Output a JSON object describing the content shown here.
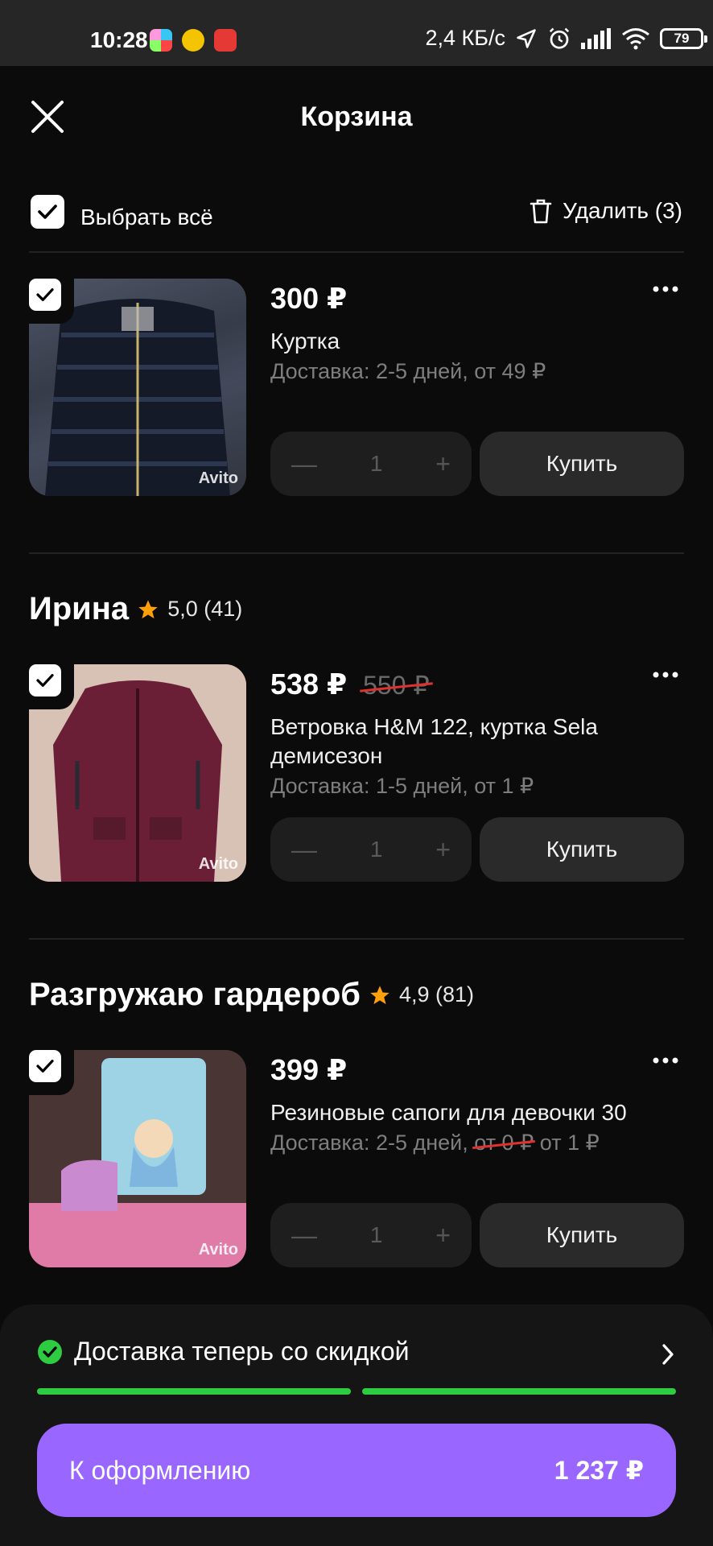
{
  "status_bar": {
    "time": "10:28",
    "speed": "2,4 КБ/с",
    "battery": "79"
  },
  "header": {
    "title": "Корзина"
  },
  "toolbar": {
    "select_all_label": "Выбрать всё",
    "delete_label": "Удалить (3)"
  },
  "sellers": [
    {
      "name": "Ирина",
      "rating": "5,0 (41)"
    },
    {
      "name": "Разгружаю гардероб",
      "rating": "4,9 (81)"
    }
  ],
  "items": [
    {
      "price": "300 ₽",
      "title": "Куртка",
      "delivery": "Доставка: 2-5 дней, от 49 ₽",
      "qty": "1",
      "buy_label": "Купить",
      "watermark": "Avito"
    },
    {
      "price": "538 ₽",
      "old_price": "550 ₽",
      "title": "Ветровка H&M 122, куртка Sela демисезон",
      "delivery": "Доставка: 1-5 дней, от 1 ₽",
      "qty": "1",
      "buy_label": "Купить",
      "watermark": "Avito"
    },
    {
      "price": "399 ₽",
      "title": "Резиновые сапоги для девочки 30",
      "delivery_prefix": "Доставка: 2-5 дней,",
      "delivery_strike": "от 0 ₽",
      "delivery_suffix": "от 1 ₽",
      "qty": "1",
      "buy_label": "Купить",
      "watermark": "Avito"
    }
  ],
  "bottom": {
    "promo_text": "Доставка теперь со скидкой",
    "checkout_label": "К оформлению",
    "checkout_total": "1 237 ₽"
  },
  "colors": {
    "accent": "#9966ff",
    "success": "#2ecc40",
    "strike_red": "#e0312f",
    "star": "#ff9f0a"
  }
}
